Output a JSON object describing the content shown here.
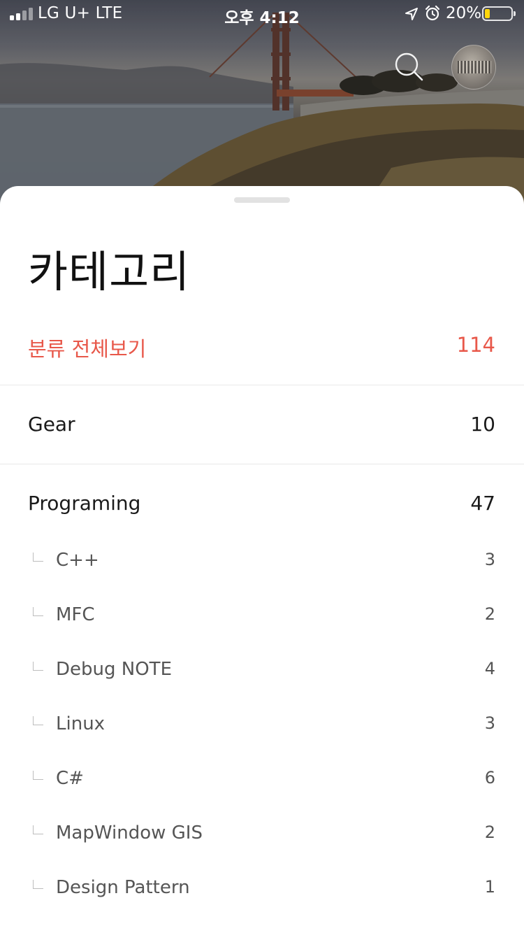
{
  "status_bar": {
    "carrier": "LG U+   LTE",
    "time": "오후 4:12",
    "battery_percent": "20%",
    "battery_level": 0.2,
    "battery_color": "#ffd60a"
  },
  "header": {
    "search_icon": "search-icon",
    "avatar": "profile-avatar"
  },
  "sheet": {
    "title": "카테고리",
    "accent_color": "#e8584a",
    "all": {
      "label": "분류 전체보기",
      "count": "114"
    },
    "categories": [
      {
        "label": "Gear",
        "count": "10"
      },
      {
        "label": "Programing",
        "count": "47"
      }
    ],
    "subcategories": [
      {
        "label": "C++",
        "count": "3"
      },
      {
        "label": "MFC",
        "count": "2"
      },
      {
        "label": "Debug NOTE",
        "count": "4"
      },
      {
        "label": "Linux",
        "count": "3"
      },
      {
        "label": "C#",
        "count": "6"
      },
      {
        "label": "MapWindow GIS",
        "count": "2"
      },
      {
        "label": "Design Pattern",
        "count": "1"
      }
    ]
  }
}
